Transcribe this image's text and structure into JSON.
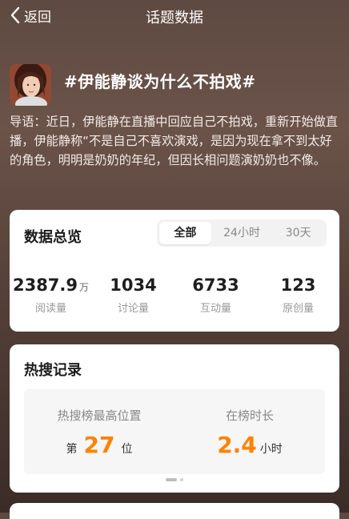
{
  "nav": {
    "back_label": "返回",
    "title": "话题数据"
  },
  "topic": {
    "title": "#伊能静谈为什么不拍戏#",
    "intro": "导语：近日，伊能静在直播中回应自己不拍戏，重新开始做直播，伊能静称“不是自己不喜欢演戏，是因为现在拿不到太好的角色，明明是奶奶的年纪，但因长相问题演奶奶也不像。"
  },
  "overview": {
    "title": "数据总览",
    "tabs": [
      {
        "label": "全部",
        "active": true
      },
      {
        "label": "24小时",
        "active": false
      },
      {
        "label": "30天",
        "active": false
      }
    ],
    "stats": [
      {
        "value": "2387.9",
        "unit": "万",
        "label": "阅读量"
      },
      {
        "value": "1034",
        "unit": "",
        "label": "讨论量"
      },
      {
        "value": "6733",
        "unit": "",
        "label": "互动量"
      },
      {
        "value": "123",
        "unit": "",
        "label": "原创量"
      }
    ]
  },
  "hot_search": {
    "title": "热搜记录",
    "peak_label": "热搜榜最高位置",
    "peak_prefix": "第",
    "peak_value": "27",
    "peak_suffix": "位",
    "duration_label": "在榜时长",
    "duration_value": "2.4",
    "duration_unit": "小时",
    "accent_color": "#ff8200",
    "pager": {
      "pages": 2,
      "current": 1
    }
  },
  "icons": {
    "back": "chevron-left-icon",
    "avatar": "avatar"
  }
}
